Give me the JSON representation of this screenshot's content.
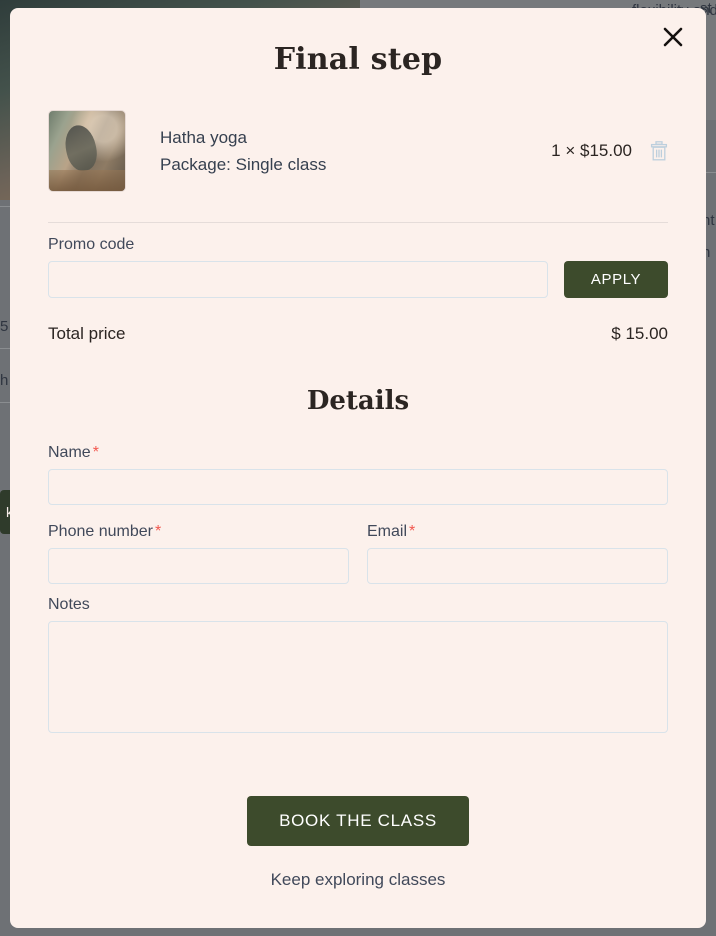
{
  "modal": {
    "title": "Final step",
    "close_label": "✕",
    "cart": {
      "item_title": "Hatha yoga",
      "item_package": "Package: Single class",
      "quantity_price": "1 × $15.00",
      "remove_icon": "trash-icon"
    },
    "promo": {
      "label": "Promo code",
      "value": "",
      "placeholder": "",
      "apply_label": "APPLY"
    },
    "total": {
      "label": "Total price",
      "value": "$ 15.00"
    },
    "details": {
      "heading": "Details",
      "required_mark": "*",
      "name": {
        "label": "Name",
        "value": "",
        "placeholder": "",
        "required": "*"
      },
      "phone": {
        "label": "Phone number",
        "value": "",
        "placeholder": "",
        "required": "*"
      },
      "email": {
        "label": "Email",
        "value": "",
        "placeholder": "",
        "required": "*"
      },
      "notes": {
        "label": "Notes",
        "value": "",
        "placeholder": ""
      }
    },
    "footer": {
      "book_label": "BOOK THE CLASS",
      "keep_exploring_label": "Keep exploring classes"
    }
  },
  "background": {
    "fragment_price": "5",
    "fragment_h": "h",
    "fragment_button": "k",
    "fragment_right_top": "st",
    "fragment_right_1": "nt",
    "fragment_right_2": "n",
    "fragment_top": "flexibility and"
  },
  "colors": {
    "modal_bg": "#fcf1ec",
    "accent_green": "#3d4b2c",
    "overlay": "#6e7175",
    "text_slate": "#36404f",
    "required_red": "#f2584f",
    "input_border": "#d9e3ea"
  }
}
